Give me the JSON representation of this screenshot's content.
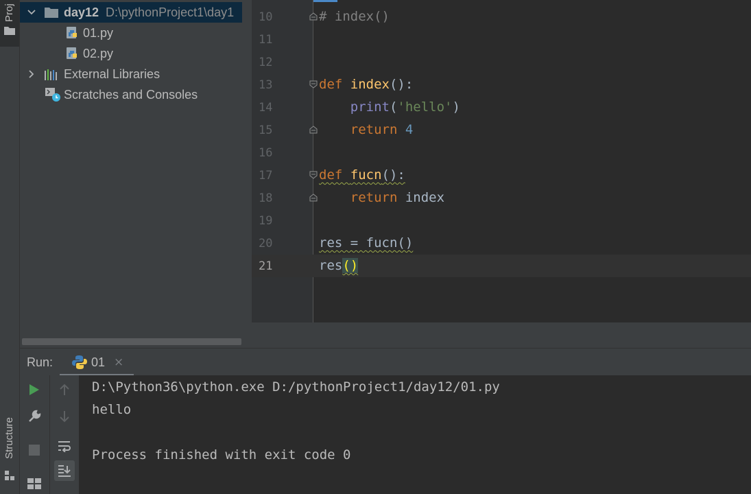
{
  "tool_stripe": {
    "project_label": "Proj",
    "structure_label": "Structure"
  },
  "project_tree": {
    "root": {
      "name": "day12",
      "path": "D:\\pythonProject1\\day1"
    },
    "files": [
      "01.py",
      "02.py"
    ],
    "external_libraries": "External Libraries",
    "scratches": "Scratches and Consoles"
  },
  "editor": {
    "lines": [
      {
        "num": "10",
        "text": "# index()"
      },
      {
        "num": "11",
        "text": ""
      },
      {
        "num": "12",
        "text": ""
      },
      {
        "num": "13",
        "text": "def index():"
      },
      {
        "num": "14",
        "text": "    print('hello')"
      },
      {
        "num": "15",
        "text": "    return 4"
      },
      {
        "num": "16",
        "text": ""
      },
      {
        "num": "17",
        "text": "def fucn():"
      },
      {
        "num": "18",
        "text": "    return index"
      },
      {
        "num": "19",
        "text": ""
      },
      {
        "num": "20",
        "text": "res = fucn()"
      },
      {
        "num": "21",
        "text": "res()"
      }
    ],
    "current_line": "21"
  },
  "run_panel": {
    "title": "Run:",
    "tab_label": "01",
    "tab_close": "×",
    "output": [
      "D:\\Python36\\python.exe D:/pythonProject1/day12/01.py",
      "hello",
      "",
      "Process finished with exit code 0"
    ]
  },
  "colors": {
    "keyword": "#cc7832",
    "function": "#ffc66d",
    "builtin": "#8888c6",
    "string": "#6a8759",
    "number": "#6897bb",
    "comment": "#808080",
    "selection": "#0d293e",
    "run_green": "#499c54"
  }
}
